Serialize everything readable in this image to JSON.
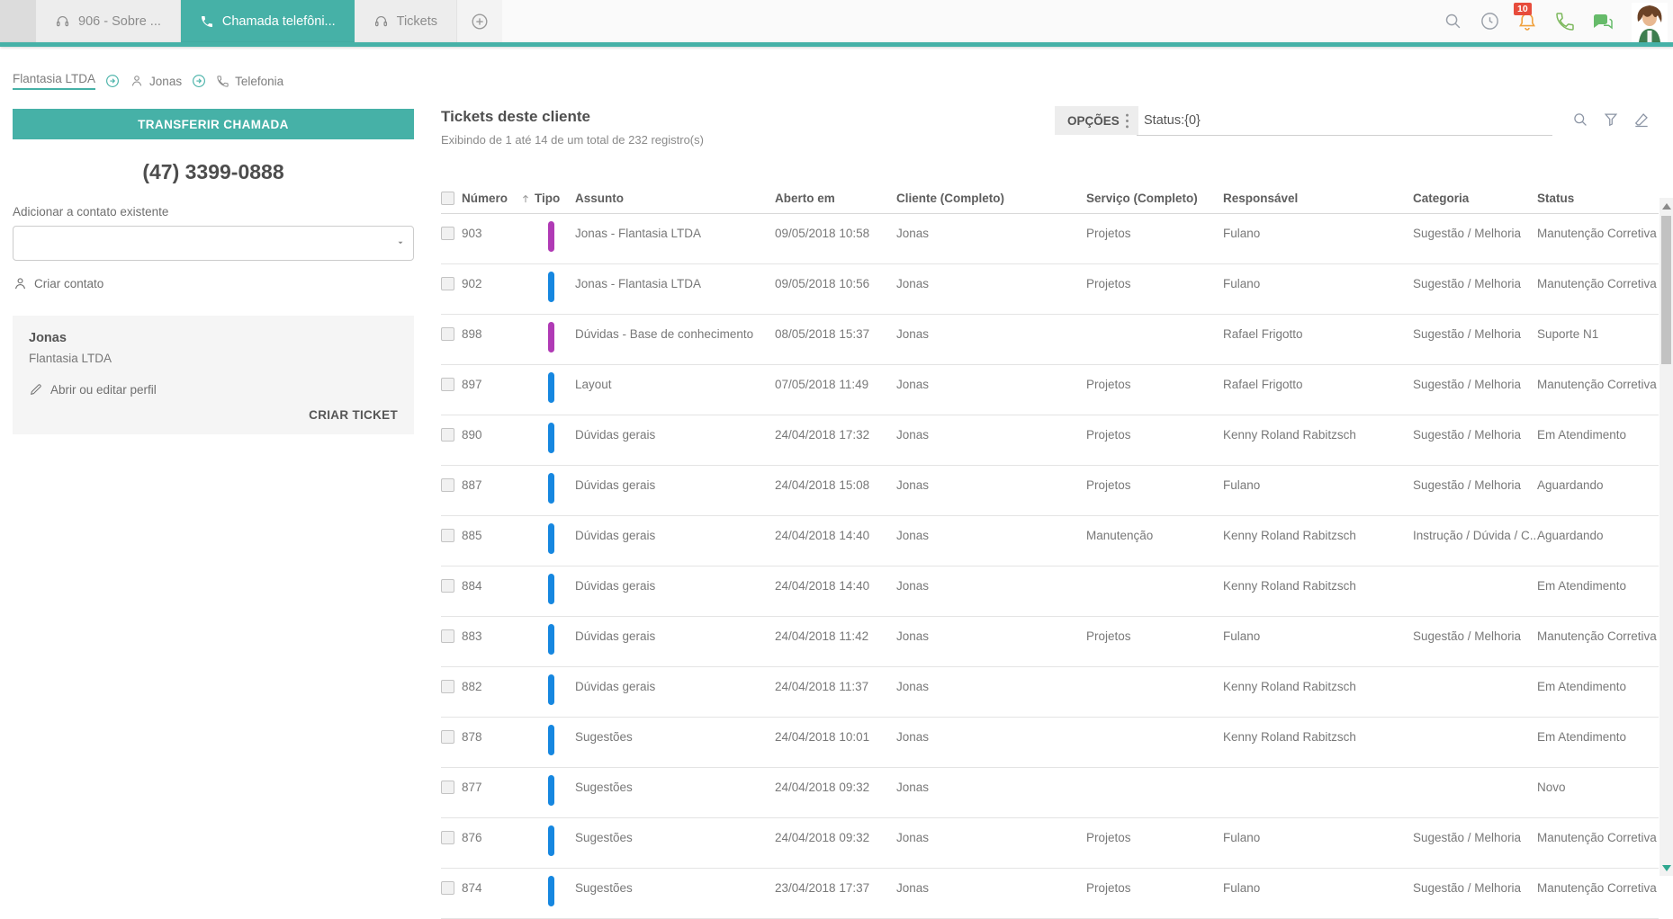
{
  "colors": {
    "accent": "#46B1A7",
    "tab_inactive_bg": "#EDEDED",
    "badge_red": "#E74C3C",
    "bell_orange": "#F0A13E",
    "phone_green": "#7CB85C",
    "chat_green": "#66BB6A",
    "bar_blue": "#1687E0",
    "bar_purple": "#B03AB5"
  },
  "icons": [
    "headset-icon",
    "phone-icon",
    "plus-icon",
    "search-icon",
    "clock-icon",
    "bell-icon",
    "chat-icon",
    "avatar",
    "arrow-right-circle-icon",
    "person-icon",
    "pencil-icon",
    "chevron-down-icon",
    "filter-icon",
    "eraser-icon",
    "sort-asc-icon",
    "options-menu-icon"
  ],
  "topbar": {
    "tabs": [
      {
        "label": "906 - Sobre ..."
      },
      {
        "label": "Chamada telefôni..."
      },
      {
        "label": "Tickets"
      }
    ],
    "notification_count": "10"
  },
  "breadcrumb": {
    "company": "Flantasia LTDA",
    "contact": "Jonas",
    "section": "Telefonia"
  },
  "call_panel": {
    "transfer_button": "TRANSFERIR CHAMADA",
    "phone_number": "(47) 3399-0888",
    "add_contact_label": "Adicionar a contato existente",
    "create_contact": "Criar contato",
    "contact": {
      "name": "Jonas",
      "company": "Flantasia LTDA",
      "edit_profile": "Abrir ou editar perfil",
      "create_ticket": "CRIAR TICKET"
    }
  },
  "tickets": {
    "title": "Tickets deste cliente",
    "subtitle": "Exibindo de 1 até 14 de um total de 232 registro(s)",
    "options_button": "OPÇÕES",
    "search_value": "Status:{0}",
    "columns": [
      "Número",
      "Tipo",
      "Assunto",
      "Aberto em",
      "Cliente (Completo)",
      "Serviço (Completo)",
      "Responsável",
      "Categoria",
      "Status"
    ],
    "rows": [
      {
        "numero": "903",
        "tipo_color": "purple",
        "assunto": "Jonas - Flantasia LTDA",
        "aberto": "09/05/2018 10:58",
        "cliente": "Jonas",
        "servico": "Projetos",
        "responsavel": "Fulano",
        "categoria": "Sugestão / Melhoria",
        "status": "Manutenção Corretiva"
      },
      {
        "numero": "902",
        "tipo_color": "blue",
        "assunto": "Jonas - Flantasia LTDA",
        "aberto": "09/05/2018 10:56",
        "cliente": "Jonas",
        "servico": "Projetos",
        "responsavel": "Fulano",
        "categoria": "Sugestão / Melhoria",
        "status": "Manutenção Corretiva"
      },
      {
        "numero": "898",
        "tipo_color": "purple",
        "assunto": "Dúvidas - Base de conhecimento",
        "aberto": "08/05/2018 15:37",
        "cliente": "Jonas",
        "servico": "",
        "responsavel": "Rafael Frigotto",
        "categoria": "Sugestão / Melhoria",
        "status": "Suporte N1"
      },
      {
        "numero": "897",
        "tipo_color": "blue",
        "assunto": "Layout",
        "aberto": "07/05/2018 11:49",
        "cliente": "Jonas",
        "servico": "Projetos",
        "responsavel": "Rafael Frigotto",
        "categoria": "Sugestão / Melhoria",
        "status": "Manutenção Corretiva"
      },
      {
        "numero": "890",
        "tipo_color": "blue",
        "assunto": "Dúvidas gerais",
        "aberto": "24/04/2018 17:32",
        "cliente": "Jonas",
        "servico": "Projetos",
        "responsavel": "Kenny Roland Rabitzsch",
        "categoria": "Sugestão / Melhoria",
        "status": "Em Atendimento"
      },
      {
        "numero": "887",
        "tipo_color": "blue",
        "assunto": "Dúvidas gerais",
        "aberto": "24/04/2018 15:08",
        "cliente": "Jonas",
        "servico": "Projetos",
        "responsavel": "Fulano",
        "categoria": "Sugestão / Melhoria",
        "status": "Aguardando"
      },
      {
        "numero": "885",
        "tipo_color": "blue",
        "assunto": "Dúvidas gerais",
        "aberto": "24/04/2018 14:40",
        "cliente": "Jonas",
        "servico": "Manutenção",
        "responsavel": "Kenny Roland Rabitzsch",
        "categoria": "Instrução / Dúvida / C...",
        "status": "Aguardando"
      },
      {
        "numero": "884",
        "tipo_color": "blue",
        "assunto": "Dúvidas gerais",
        "aberto": "24/04/2018 14:40",
        "cliente": "Jonas",
        "servico": "",
        "responsavel": "Kenny Roland Rabitzsch",
        "categoria": "",
        "status": "Em Atendimento"
      },
      {
        "numero": "883",
        "tipo_color": "blue",
        "assunto": "Dúvidas gerais",
        "aberto": "24/04/2018 11:42",
        "cliente": "Jonas",
        "servico": "Projetos",
        "responsavel": "Fulano",
        "categoria": "Sugestão / Melhoria",
        "status": "Manutenção Corretiva"
      },
      {
        "numero": "882",
        "tipo_color": "blue",
        "assunto": "Dúvidas gerais",
        "aberto": "24/04/2018 11:37",
        "cliente": "Jonas",
        "servico": "",
        "responsavel": "Kenny Roland Rabitzsch",
        "categoria": "",
        "status": "Em Atendimento"
      },
      {
        "numero": "878",
        "tipo_color": "blue",
        "assunto": "Sugestões",
        "aberto": "24/04/2018 10:01",
        "cliente": "Jonas",
        "servico": "",
        "responsavel": "Kenny Roland Rabitzsch",
        "categoria": "",
        "status": "Em Atendimento"
      },
      {
        "numero": "877",
        "tipo_color": "blue",
        "assunto": "Sugestões",
        "aberto": "24/04/2018 09:32",
        "cliente": "Jonas",
        "servico": "",
        "responsavel": "",
        "categoria": "",
        "status": "Novo"
      },
      {
        "numero": "876",
        "tipo_color": "blue",
        "assunto": "Sugestões",
        "aberto": "24/04/2018 09:32",
        "cliente": "Jonas",
        "servico": "Projetos",
        "responsavel": "Fulano",
        "categoria": "Sugestão / Melhoria",
        "status": "Manutenção Corretiva"
      },
      {
        "numero": "874",
        "tipo_color": "blue",
        "assunto": "Sugestões",
        "aberto": "23/04/2018 17:37",
        "cliente": "Jonas",
        "servico": "Projetos",
        "responsavel": "Fulano",
        "categoria": "Sugestão / Melhoria",
        "status": "Manutenção Corretiva"
      }
    ]
  }
}
